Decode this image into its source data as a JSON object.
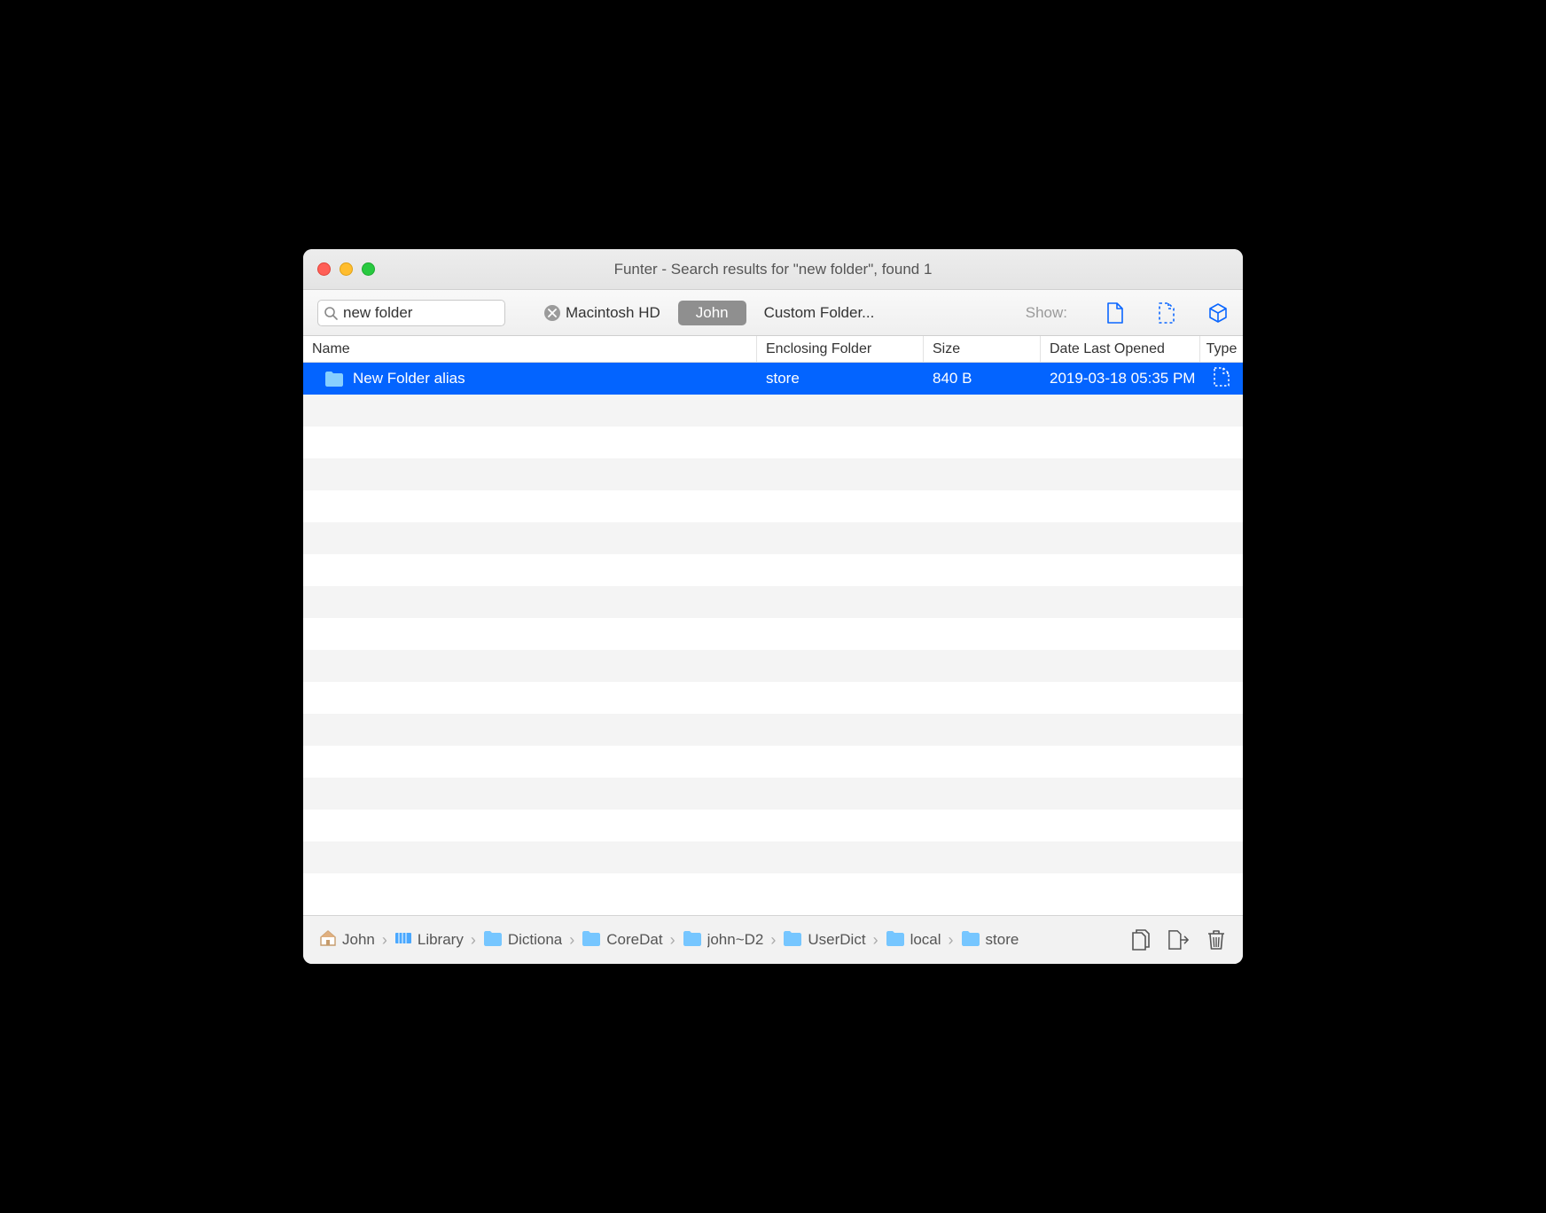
{
  "window": {
    "title": "Funter - Search results for \"new folder\", found 1"
  },
  "toolbar": {
    "search_value": "new folder",
    "scopes": [
      {
        "label": "Macintosh HD",
        "active": false
      },
      {
        "label": "John",
        "active": true
      },
      {
        "label": "Custom Folder...",
        "active": false
      }
    ],
    "show_label": "Show:"
  },
  "columns": {
    "name": "Name",
    "enclosing": "Enclosing Folder",
    "size": "Size",
    "date": "Date Last Opened",
    "type": "Type"
  },
  "rows": [
    {
      "name": "New Folder alias",
      "enclosing": "store",
      "size": "840 B",
      "date": "2019-03-18 05:35 PM",
      "selected": true
    }
  ],
  "empty_row_count": 16,
  "path": [
    {
      "label": "John",
      "icon": "home"
    },
    {
      "label": "Library",
      "icon": "library"
    },
    {
      "label": "Dictiona",
      "icon": "folder"
    },
    {
      "label": "CoreDat",
      "icon": "folder"
    },
    {
      "label": "john~D2",
      "icon": "folder"
    },
    {
      "label": "UserDict",
      "icon": "folder"
    },
    {
      "label": "local",
      "icon": "folder"
    },
    {
      "label": "store",
      "icon": "folder"
    }
  ],
  "colors": {
    "accent": "#0364ff"
  }
}
